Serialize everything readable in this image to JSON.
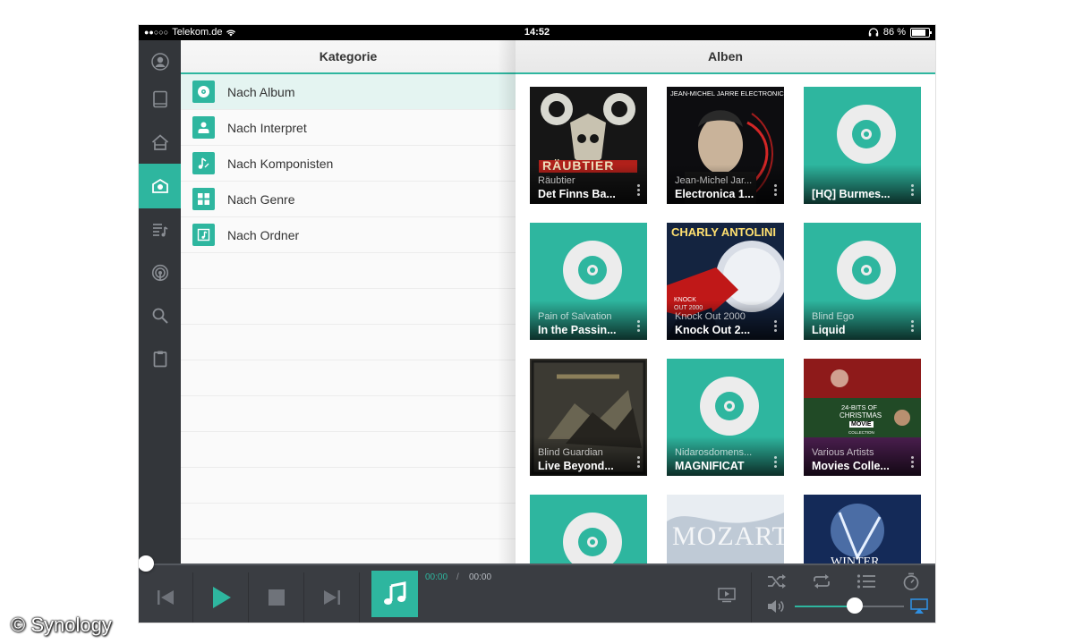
{
  "status": {
    "carrier": "Telekom.de",
    "time": "14:52",
    "battery": "86 %",
    "battery_level": 0.86
  },
  "sidebar": {
    "items": [
      {
        "icon": "user-icon"
      },
      {
        "icon": "tablet-icon"
      },
      {
        "icon": "home-icon"
      },
      {
        "icon": "library-icon",
        "active": true
      },
      {
        "icon": "playlist-icon"
      },
      {
        "icon": "radio-icon"
      },
      {
        "icon": "search-icon"
      },
      {
        "icon": "clipboard-icon"
      }
    ]
  },
  "left_panel": {
    "title": "Kategorie",
    "items": [
      {
        "label": "Nach Album",
        "icon": "disc-icon",
        "active": true
      },
      {
        "label": "Nach Interpret",
        "icon": "person-icon"
      },
      {
        "label": "Nach Komponisten",
        "icon": "composer-note-icon"
      },
      {
        "label": "Nach Genre",
        "icon": "genre-grid-icon"
      },
      {
        "label": "Nach Ordner",
        "icon": "folder-music-icon"
      }
    ]
  },
  "right_panel": {
    "title": "Alben",
    "albums": [
      {
        "artist": "Räubtier",
        "title": "Det Finns Ba...",
        "cover": "art"
      },
      {
        "artist": "Jean-Michel Jar...",
        "title": "Electronica 1...",
        "cover": "art"
      },
      {
        "artist": "",
        "title": "[HQ] Burmes...",
        "cover": "placeholder"
      },
      {
        "artist": "Pain of Salvation",
        "title": "In the Passin...",
        "cover": "placeholder"
      },
      {
        "artist": "Knock Out 2000",
        "title": "Knock Out 2...",
        "cover": "art"
      },
      {
        "artist": "Blind Ego",
        "title": "Liquid",
        "cover": "placeholder"
      },
      {
        "artist": "Blind Guardian",
        "title": "Live Beyond...",
        "cover": "art"
      },
      {
        "artist": "Nidarosdomens...",
        "title": "MAGNIFICAT",
        "cover": "placeholder"
      },
      {
        "artist": "Various Artists",
        "title": "Movies Colle...",
        "cover": "art"
      },
      {
        "artist": "",
        "title": "",
        "cover": "placeholder"
      },
      {
        "artist": "",
        "title": "",
        "cover": "art"
      },
      {
        "artist": "",
        "title": "",
        "cover": "art"
      }
    ],
    "cover_texts": {
      "raeubtier": "RÄUBTIER",
      "jarre_top": "JEAN-MICHEL JARRE ELECTRONICA",
      "charly": "CHARLY ANTOLINI",
      "knockout": "KNOCK OUT 2000",
      "movies_top": "24-BITS OF",
      "movies_mid": "CHRISTMAS",
      "movies_box": "MOVIE",
      "movies_coll": "COLLECTION",
      "mozart": "MOZART",
      "winter": "WINTER"
    }
  },
  "player": {
    "elapsed": "00:00",
    "separator": "/",
    "duration": "00:00",
    "progress": 0,
    "volume": 0.55
  },
  "colors": {
    "accent": "#2eb69f",
    "sidebar_bg": "#33363a",
    "player_bg": "#3a3d42"
  },
  "watermark": "© Synology"
}
